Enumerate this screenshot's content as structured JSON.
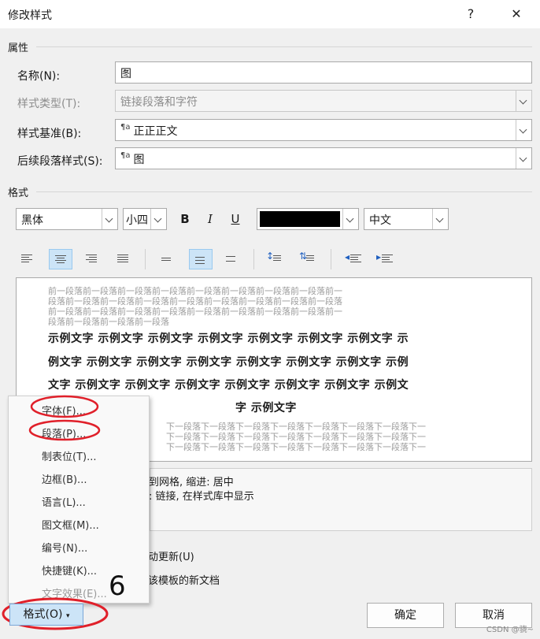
{
  "dialog": {
    "title": "修改样式",
    "help_label": "?",
    "close_label": "✕"
  },
  "properties": {
    "section": "属性",
    "name_label": "名称(N):",
    "name_value": "图",
    "style_type_label": "样式类型(T):",
    "style_type_value": "链接段落和字符",
    "based_on_label": "样式基准(B):",
    "based_on_value": "正正正文",
    "following_label": "后续段落样式(S):",
    "following_value": "图",
    "para_mark": "¶a"
  },
  "format": {
    "section": "格式",
    "font": "黑体",
    "size": "小四",
    "bold": "B",
    "italic": "I",
    "underline": "U",
    "color_hex": "#000000",
    "script": "中文"
  },
  "preview": {
    "before_lines": [
      "前一段落前一段落前一段落前一段落前一段落前一段落前一段落前一段落前一",
      "段落前一段落前一段落前一段落前一段落前一段落前一段落前一段落前一段落",
      "前一段落前一段落前一段落前一段落前一段落前一段落前一段落前一段落前一",
      "段落前一段落前一段落前一段落"
    ],
    "sample_lines": [
      "示例文字 示例文字 示例文字 示例文字 示例文字 示例文字 示例文字 示",
      "例文字 示例文字 示例文字 示例文字 示例文字 示例文字 示例文字 示例",
      "文字 示例文字 示例文字 示例文字 示例文字 示例文字 示例文字 示例文",
      "字 示例文字"
    ],
    "after_lines": [
      "下一段落下一段落下一段落下一段落下一段落下一段落下一段落下一",
      "下一段落下一段落下一段落下一段落下一段落下一段落下一段落下一",
      "下一段落下一段落下一段落下一段落下一段落下一段落下一段落下一"
    ]
  },
  "description": {
    "line1": "到网格, 缩进: 居中",
    "line2": ": 链接, 在样式库中显示"
  },
  "options": {
    "auto_update": "动更新(U)",
    "new_docs": "该模板的新文档"
  },
  "menu": {
    "items": [
      {
        "label": "字体(F)...",
        "enabled": true
      },
      {
        "label": "段落(P)...",
        "enabled": true
      },
      {
        "label": "制表位(T)...",
        "enabled": true
      },
      {
        "label": "边框(B)...",
        "enabled": true
      },
      {
        "label": "语言(L)...",
        "enabled": true
      },
      {
        "label": "图文框(M)...",
        "enabled": true
      },
      {
        "label": "编号(N)...",
        "enabled": true
      },
      {
        "label": "快捷键(K)...",
        "enabled": true
      },
      {
        "label": "文字效果(E)...",
        "enabled": false
      }
    ]
  },
  "buttons": {
    "format": "格式(O)",
    "ok": "确定",
    "cancel": "取消"
  },
  "annotation": {
    "step": "6",
    "highlight_color": "#e0202a"
  },
  "watermark": "CSDN @骁~"
}
